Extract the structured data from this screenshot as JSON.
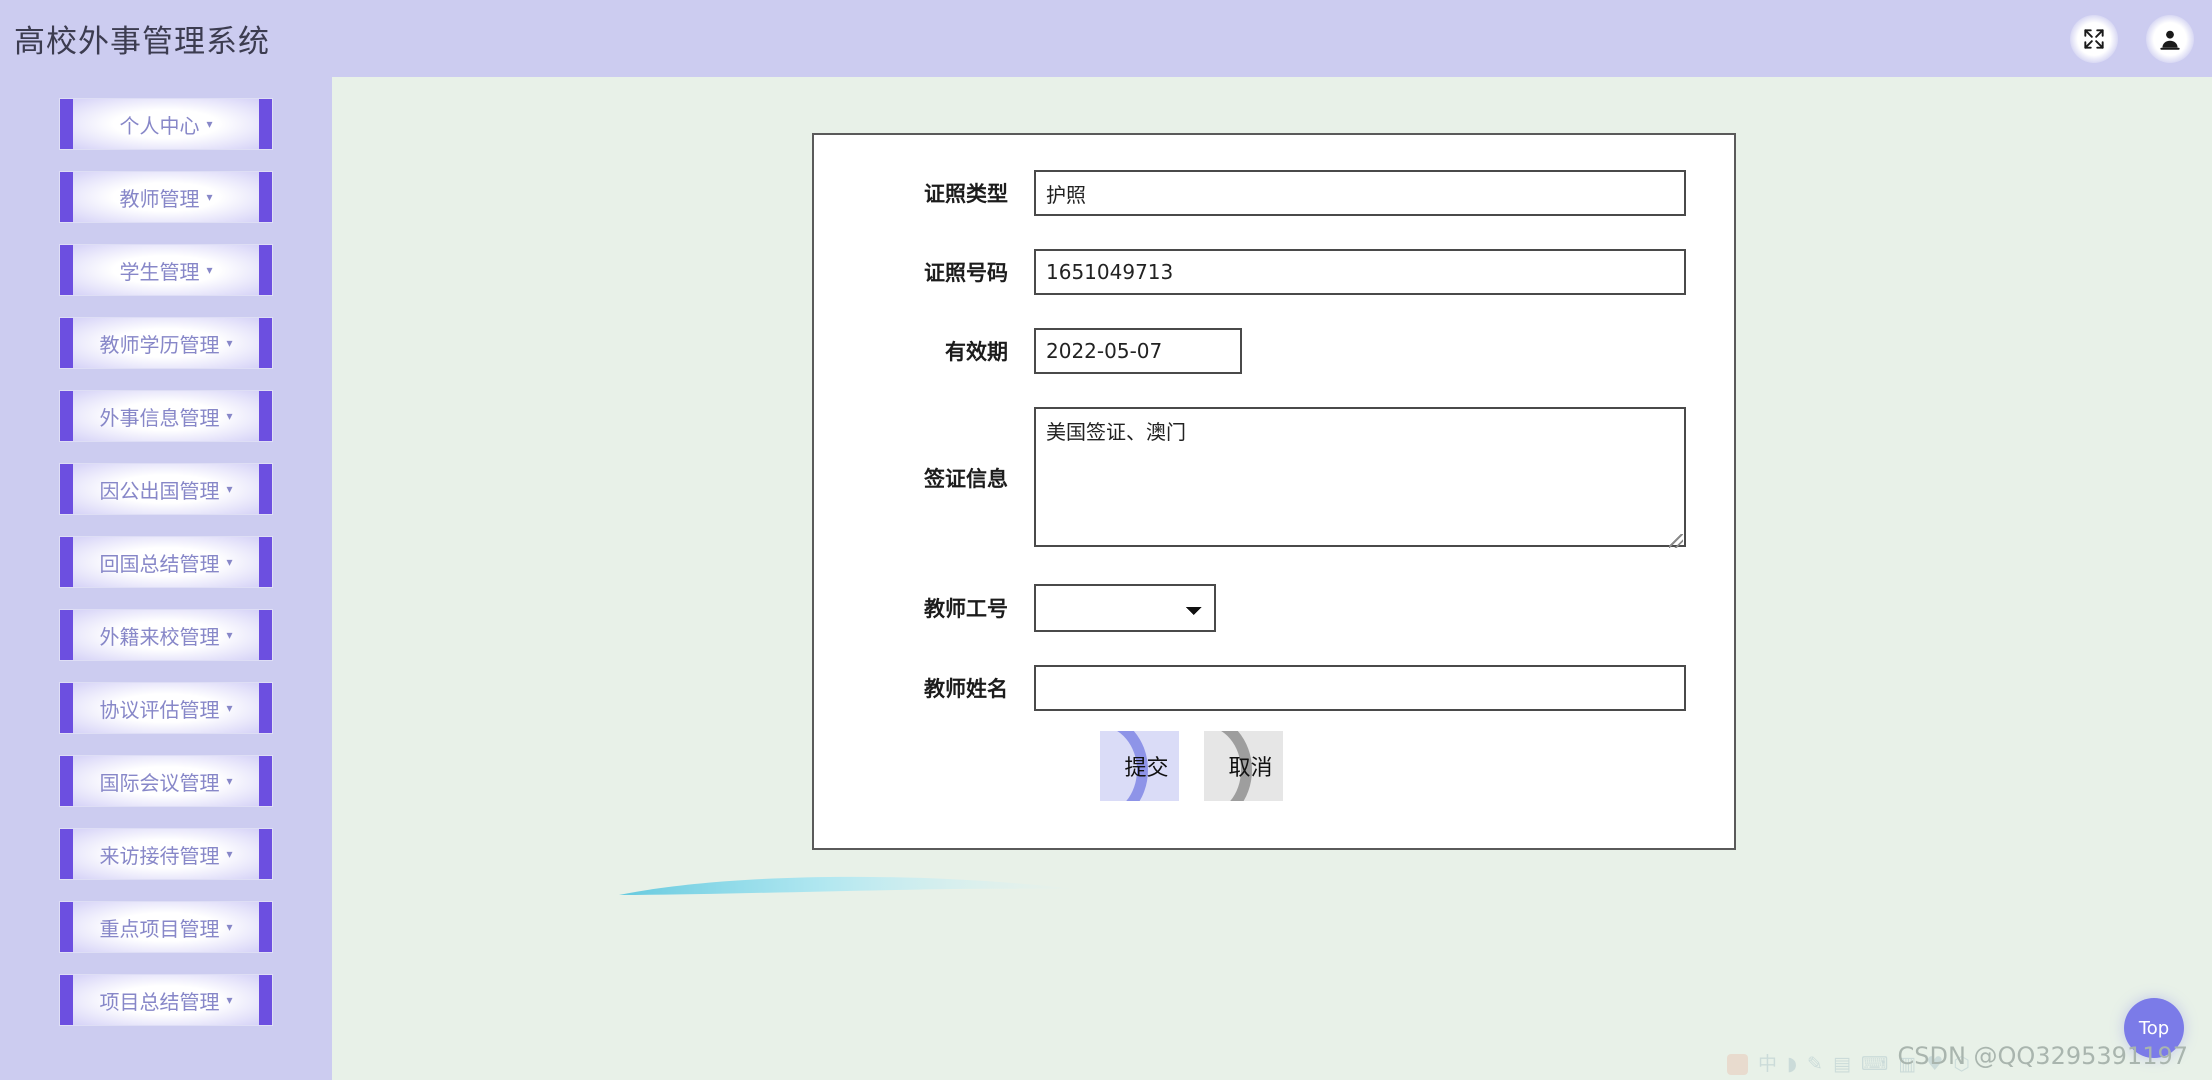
{
  "header": {
    "title": "高校外事管理系统",
    "actions": [
      {
        "name": "fullscreen-icon",
        "label": "全屏"
      },
      {
        "name": "user-icon",
        "label": "用户"
      }
    ]
  },
  "sidebar": {
    "items": [
      {
        "label": "个人中心",
        "caret": "▾"
      },
      {
        "label": "教师管理",
        "caret": "▾"
      },
      {
        "label": "学生管理",
        "caret": "▾"
      },
      {
        "label": "教师学历管理",
        "caret": "▾"
      },
      {
        "label": "外事信息管理",
        "caret": "▾"
      },
      {
        "label": "因公出国管理",
        "caret": "▾"
      },
      {
        "label": "回国总结管理",
        "caret": "▾"
      },
      {
        "label": "外籍来校管理",
        "caret": "▾"
      },
      {
        "label": "协议评估管理",
        "caret": "▾"
      },
      {
        "label": "国际会议管理",
        "caret": "▾"
      },
      {
        "label": "来访接待管理",
        "caret": "▾"
      },
      {
        "label": "重点项目管理",
        "caret": "▾"
      },
      {
        "label": "项目总结管理",
        "caret": "▾"
      }
    ]
  },
  "form": {
    "fields": {
      "cert_type": {
        "label": "证照类型",
        "value": "护照",
        "placeholder": ""
      },
      "cert_number": {
        "label": "证照号码",
        "value": "1651049713",
        "placeholder": ""
      },
      "valid_date": {
        "label": "有效期",
        "value": "2022-05-07",
        "placeholder": ""
      },
      "visa_info": {
        "label": "签证信息",
        "value": "美国签证、澳门",
        "placeholder": ""
      },
      "teacher_id": {
        "label": "教师工号",
        "value": "",
        "placeholder": "",
        "options": [
          ""
        ]
      },
      "teacher_name": {
        "label": "教师姓名",
        "value": "",
        "placeholder": ""
      }
    },
    "buttons": {
      "submit": "提交",
      "cancel": "取消"
    }
  },
  "footer": {
    "top_button": "Top",
    "watermark": "CSDN @QQ3295391197",
    "ime": {
      "items": [
        "中",
        "◗",
        "✎",
        "▤",
        "⌨",
        "▥",
        "♥",
        "⬡"
      ]
    }
  },
  "colors": {
    "header_bg": "#ccccf0",
    "sidebar_bg": "#ccccf0",
    "content_bg": "#e8f1e8",
    "accent_purple": "#6c4fe0",
    "menu_text": "#8787c8",
    "submit_bg": "#dadcf7",
    "cancel_bg": "#e6e6e6",
    "top_btn": "#7b7be8",
    "swoosh": "#9fdff0"
  }
}
